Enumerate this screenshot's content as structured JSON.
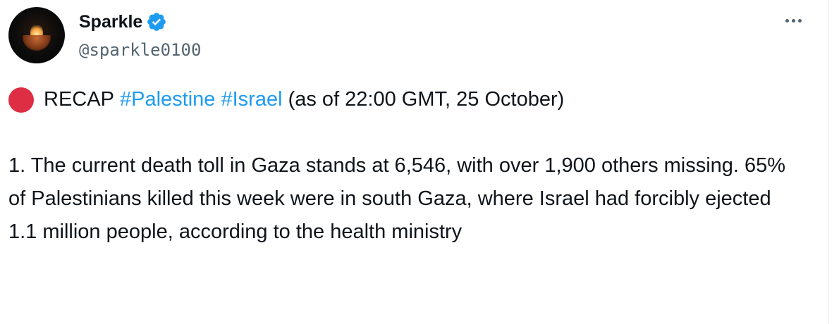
{
  "author": {
    "display_name": "Sparkle",
    "handle": "@sparkle0100",
    "avatar_icon": "candle-in-hands-avatar",
    "verified_icon": "verified-badge-icon"
  },
  "menu": {
    "icon": "more-horizontal-icon"
  },
  "tweet": {
    "emoji": "red-circle-icon",
    "line1_prefix": "RECAP",
    "hashtags": [
      "#Palestine",
      "#Israel"
    ],
    "line1_suffix": "(as of 22:00 GMT, 25 October)",
    "paragraph": "1. The current death toll in Gaza stands at 6,546, with over 1,900 others missing. 65% of Palestinians killed this week were in south Gaza, where Israel had forcibly ejected 1.1 million people, according to the health ministry"
  },
  "colors": {
    "link": "#1d9bf0",
    "verified": "#1d9bf0",
    "text": "#0f1419",
    "secondary": "#536471",
    "red_circle": "#dd2e44"
  }
}
